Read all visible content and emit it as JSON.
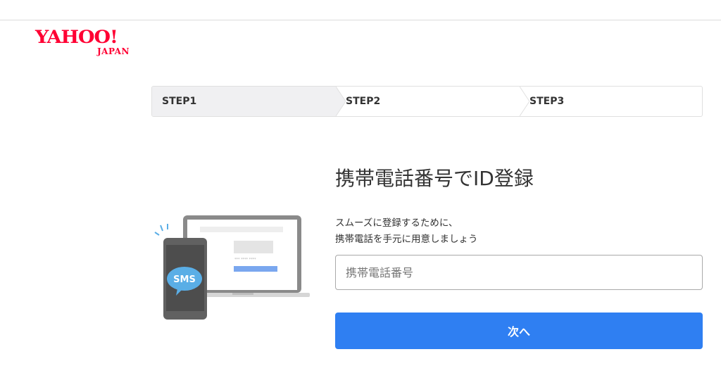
{
  "logo": {
    "main": "YAHOO!",
    "sub": "JAPAN"
  },
  "steps": [
    {
      "label": "STEP1",
      "active": true
    },
    {
      "label": "STEP2",
      "active": false
    },
    {
      "label": "STEP3",
      "active": false
    }
  ],
  "main": {
    "title": "携帯電話番号でID登録",
    "desc_line1": "スムーズに登録するために、",
    "desc_line2": "携帯電話を手元に用意しましょう",
    "phone_placeholder": "携帯電話番号",
    "next_label": "次へ"
  },
  "illustration": {
    "bubble_text": "SMS"
  },
  "colors": {
    "brand": "#ff0033",
    "accent": "#2f7ff2",
    "step_active_bg": "#f0f0f2"
  }
}
